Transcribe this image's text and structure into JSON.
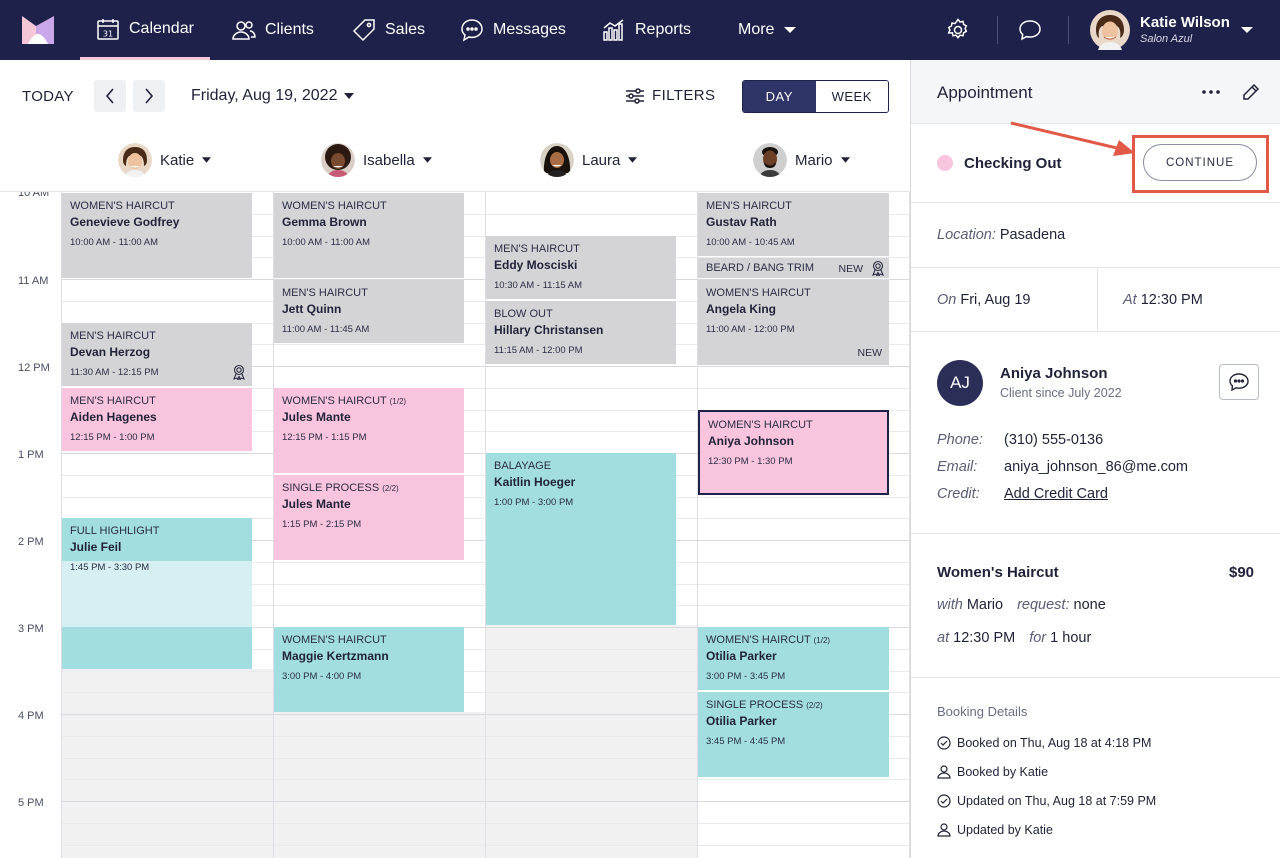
{
  "nav": {
    "items": [
      {
        "label": "Calendar",
        "icon": "calendar-icon",
        "active": true
      },
      {
        "label": "Clients",
        "icon": "users-icon"
      },
      {
        "label": "Sales",
        "icon": "tag-icon"
      },
      {
        "label": "Messages",
        "icon": "message-dots-icon"
      },
      {
        "label": "Reports",
        "icon": "bar-chart-icon"
      },
      {
        "label": "More",
        "icon": "chevron-down-icon"
      }
    ],
    "user": {
      "name": "Katie Wilson",
      "salon": "Salon Azul"
    }
  },
  "toolbar": {
    "today_label": "TODAY",
    "date_label": "Friday, Aug 19, 2022",
    "filters_label": "FILTERS",
    "view_day": "DAY",
    "view_week": "WEEK"
  },
  "staff": [
    {
      "name": "Katie"
    },
    {
      "name": "Isabella"
    },
    {
      "name": "Laura"
    },
    {
      "name": "Mario"
    }
  ],
  "time_labels": [
    "10 AM",
    "11 AM",
    "12 PM",
    "1 PM",
    "2 PM",
    "3 PM",
    "4 PM",
    "5 PM"
  ],
  "appointments": [
    {
      "service": "WOMEN'S HAIRCUT",
      "client": "Genevieve Godfrey",
      "time": "10:00 AM - 11:00 AM"
    },
    {
      "service": "MEN'S HAIRCUT",
      "client": "Devan Herzog",
      "time": "11:30 AM - 12:15 PM"
    },
    {
      "service": "MEN'S HAIRCUT",
      "client": "Aiden Hagenes",
      "time": "12:15 PM - 1:00 PM"
    },
    {
      "service": "FULL HIGHLIGHT",
      "client": "Julie Feil",
      "time": "1:45 PM - 3:30 PM"
    },
    {
      "service": "WOMEN'S HAIRCUT",
      "client": "Gemma Brown",
      "time": "10:00 AM - 11:00 AM"
    },
    {
      "service": "MEN'S HAIRCUT",
      "client": "Jett Quinn",
      "time": "11:00 AM - 11:45 AM"
    },
    {
      "service": "WOMEN'S HAIRCUT",
      "part": "(1/2)",
      "client": "Jules Mante",
      "time": "12:15 PM - 1:15 PM"
    },
    {
      "service": "SINGLE PROCESS",
      "part": "(2/2)",
      "client": "Jules Mante",
      "time": "1:15 PM - 2:15 PM"
    },
    {
      "service": "WOMEN'S HAIRCUT",
      "client": "Maggie Kertzmann",
      "time": "3:00 PM - 4:00 PM"
    },
    {
      "service": "MEN'S HAIRCUT",
      "client": "Eddy Mosciski",
      "time": "10:30 AM - 11:15 AM"
    },
    {
      "service": "BLOW OUT",
      "client": "Hillary Christansen",
      "time": "11:15 AM - 12:00 PM"
    },
    {
      "service": "BALAYAGE",
      "client": "Kaitlin Hoeger",
      "time": "1:00 PM - 3:00 PM"
    },
    {
      "service": "MEN'S HAIRCUT",
      "client": "Gustav Rath",
      "time": "10:00 AM - 10:45 AM"
    },
    {
      "service": "BEARD / BANG TRIM",
      "badge": "NEW"
    },
    {
      "service": "WOMEN'S HAIRCUT",
      "client": "Angela King",
      "time": "11:00 AM - 12:00 PM",
      "badge": "NEW"
    },
    {
      "service": "WOMEN'S HAIRCUT",
      "client": "Aniya Johnson",
      "time": "12:30 PM - 1:30 PM",
      "selected": true
    },
    {
      "service": "WOMEN'S HAIRCUT",
      "part": "(1/2)",
      "client": "Otilia Parker",
      "time": "3:00 PM - 3:45 PM"
    },
    {
      "service": "SINGLE PROCESS",
      "part": "(2/2)",
      "client": "Otilia Parker",
      "time": "3:45 PM - 4:45 PM"
    }
  ],
  "panel": {
    "title": "Appointment",
    "status": "Checking Out",
    "status_color": "#f9c4dd",
    "continue_label": "CONTINUE",
    "location_label": "Location:",
    "location": "Pasadena",
    "on_label": "On",
    "on_value": "Fri, Aug 19",
    "at_label": "At",
    "at_value": "12:30 PM",
    "client": {
      "initials": "AJ",
      "name": "Aniya Johnson",
      "since": "Client since July 2022",
      "phone_label": "Phone:",
      "phone": "(310) 555-0136",
      "email_label": "Email:",
      "email": "aniya_johnson_86@me.com",
      "credit_label": "Credit:",
      "credit_link": "Add Credit Card"
    },
    "service": {
      "name": "Women's Haircut",
      "price": "$90",
      "with_label": "with",
      "with": "Mario",
      "request_label": "request:",
      "request": "none",
      "at_label": "at",
      "at": "12:30 PM",
      "for_label": "for",
      "for": "1 hour"
    },
    "booking": {
      "title": "Booking Details",
      "rows": [
        {
          "icon": "clock-icon",
          "text": "Booked on Thu, Aug 18 at 4:18 PM"
        },
        {
          "icon": "person-icon",
          "text": "Booked by Katie"
        },
        {
          "icon": "clock-icon",
          "text": "Updated on Thu, Aug 18 at 7:59 PM"
        },
        {
          "icon": "person-icon",
          "text": "Updated by Katie"
        }
      ]
    }
  },
  "colors": {
    "nav_bg": "#1e2149",
    "gray": "#d4d4d6",
    "pink": "#f9c4dd",
    "teal": "#a2dde0",
    "highlight": "#e25a47"
  }
}
